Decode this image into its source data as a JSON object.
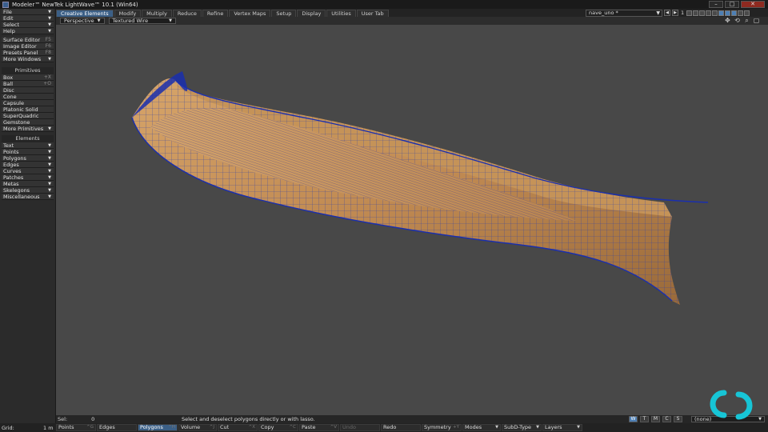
{
  "window": {
    "title": "Modeler™ NewTek LightWave™ 10.1 (Win64)"
  },
  "tabs": [
    {
      "label": "Creative Elements",
      "active": true
    },
    {
      "label": "Modify"
    },
    {
      "label": "Multiply"
    },
    {
      "label": "Reduce"
    },
    {
      "label": "Refine"
    },
    {
      "label": "Vertex Maps"
    },
    {
      "label": "Setup"
    },
    {
      "label": "Display"
    },
    {
      "label": "Utilities"
    },
    {
      "label": "User Tab"
    }
  ],
  "layer": {
    "name": "nave_uno *",
    "number": "1"
  },
  "viewport": {
    "view": "Perspective",
    "shading": "Textured Wire"
  },
  "sidebar": {
    "menus": [
      {
        "label": "File"
      },
      {
        "label": "Edit"
      },
      {
        "label": "Select"
      },
      {
        "label": "Help"
      }
    ],
    "tools": [
      {
        "label": "Surface Editor",
        "shortcut": "F5"
      },
      {
        "label": "Image Editor",
        "shortcut": "F6"
      },
      {
        "label": "Presets Panel",
        "shortcut": "F8"
      },
      {
        "label": "More Windows"
      }
    ],
    "primitives_title": "Primitives",
    "primitives": [
      {
        "label": "Box",
        "shortcut": "+X"
      },
      {
        "label": "Ball",
        "shortcut": "+O"
      },
      {
        "label": "Disc"
      },
      {
        "label": "Cone"
      },
      {
        "label": "Capsule"
      },
      {
        "label": "Platonic Solid"
      },
      {
        "label": "SuperQuadric"
      },
      {
        "label": "Gemstone"
      },
      {
        "label": "More Primitives"
      }
    ],
    "elements_title": "Elements",
    "elements": [
      {
        "label": "Text"
      },
      {
        "label": "Points"
      },
      {
        "label": "Polygons"
      },
      {
        "label": "Edges"
      },
      {
        "label": "Curves"
      },
      {
        "label": "Patches"
      },
      {
        "label": "Metas"
      },
      {
        "label": "Skelegons"
      },
      {
        "label": "Miscellaneous"
      }
    ]
  },
  "status": {
    "sel_label": "Sel:",
    "sel_count": "0",
    "help": "Select and deselect polygons directly or with lasso.",
    "view_buttons": [
      "W",
      "T",
      "M",
      "C",
      "S"
    ],
    "view_active": "W",
    "surface": "(none)"
  },
  "bottom": {
    "grid_label": "Grid:",
    "grid_value": "1 m",
    "buttons": {
      "points": {
        "label": "Points",
        "sc": "^G"
      },
      "edges": {
        "label": "Edges"
      },
      "polygons": {
        "label": "Polygons",
        "sc": "^H"
      },
      "volume": {
        "label": "Volume",
        "sc": "^J"
      },
      "cut": {
        "label": "Cut",
        "sc": "^X"
      },
      "copy": {
        "label": "Copy",
        "sc": "^C"
      },
      "paste": {
        "label": "Paste",
        "sc": "^V"
      },
      "undo": {
        "label": "Undo"
      },
      "redo": {
        "label": "Redo"
      },
      "symmetry": {
        "label": "Symmetry",
        "sc": "+Y"
      },
      "modes": {
        "label": "Modes"
      },
      "subd": {
        "label": "SubD-Type"
      },
      "layers": {
        "label": "Layers"
      }
    }
  },
  "colors": {
    "accent": "#3b5f86",
    "wood": "#c08a52",
    "wire": "#1a2fae"
  }
}
